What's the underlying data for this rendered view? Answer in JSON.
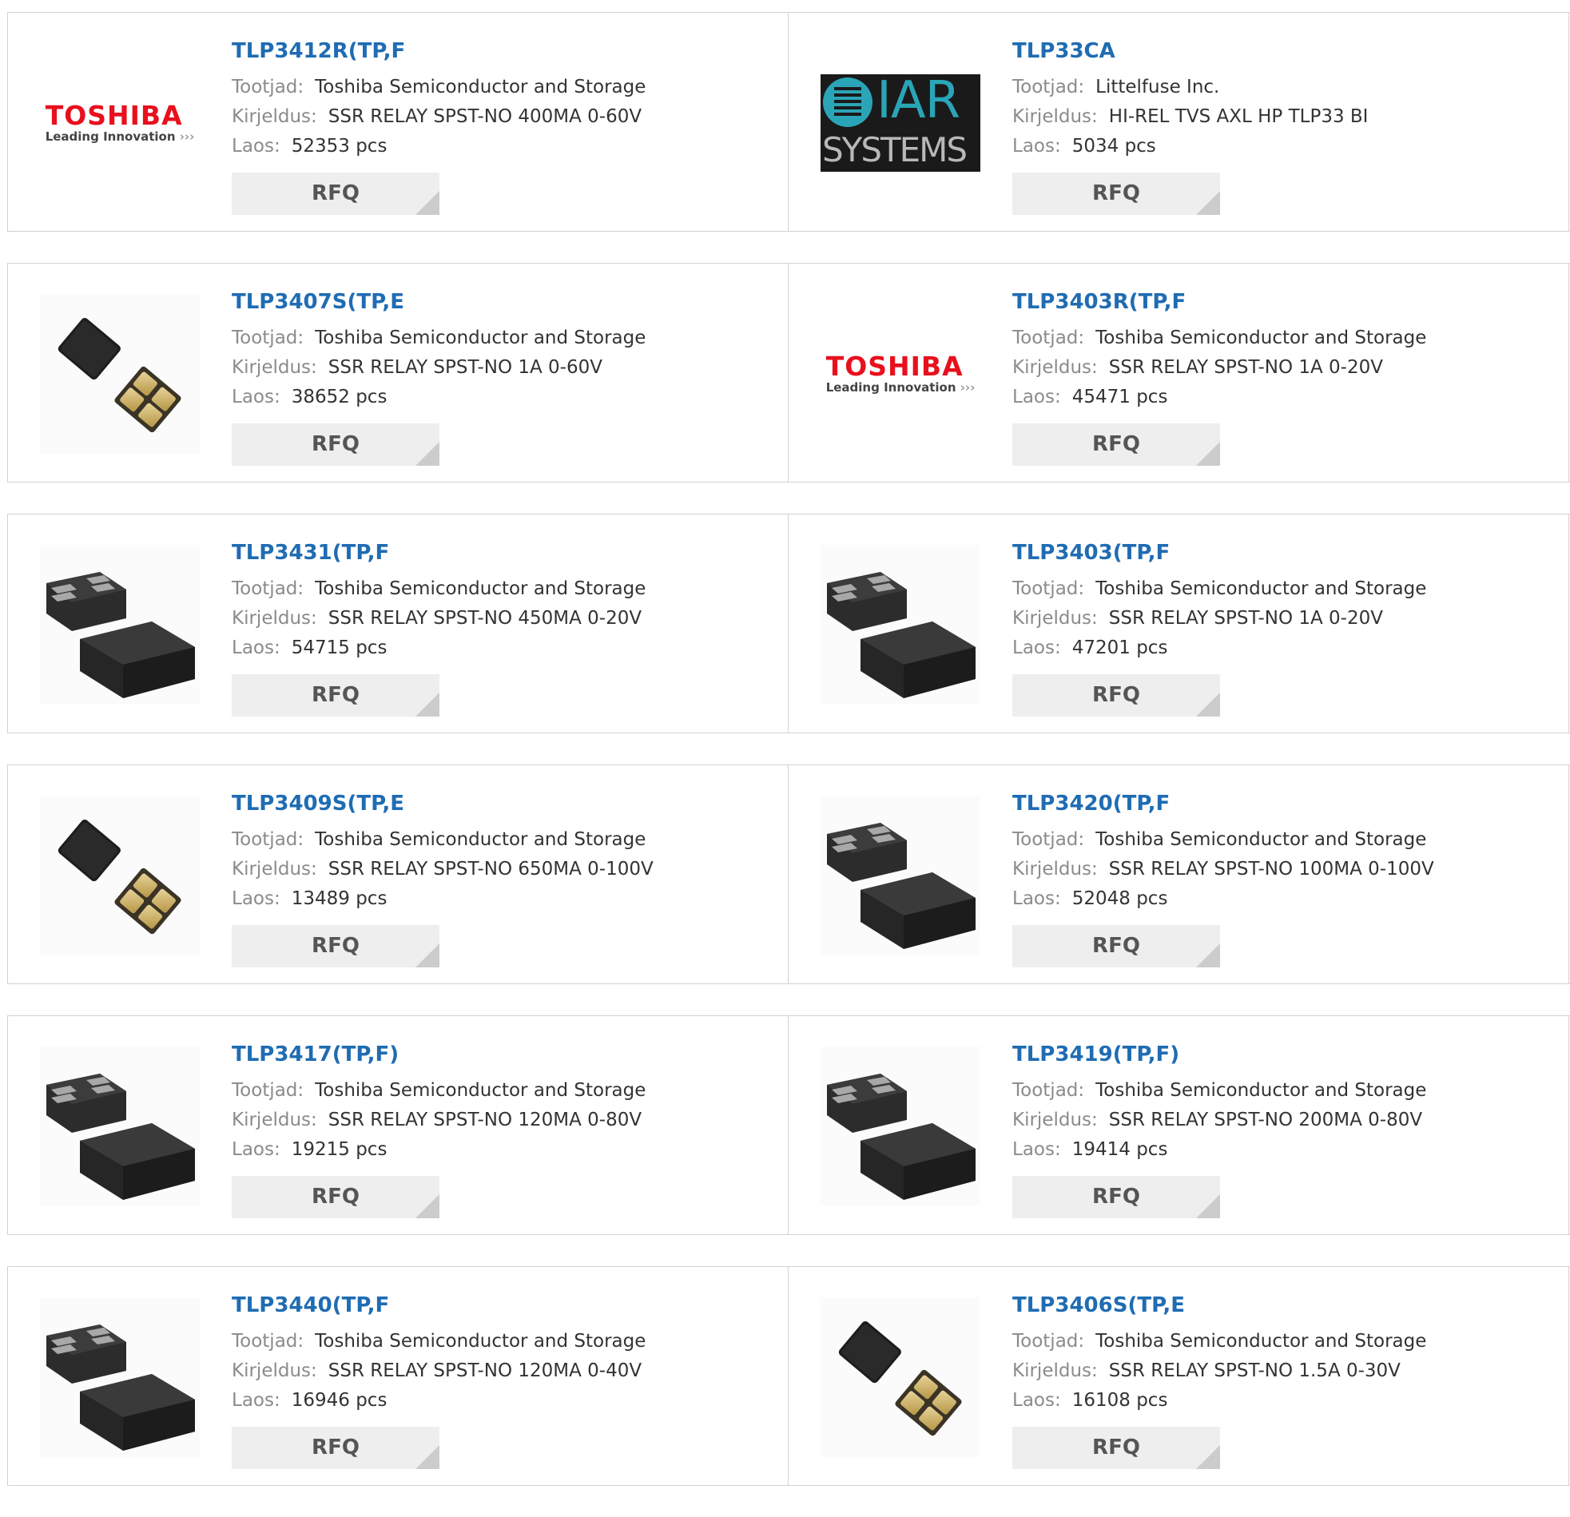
{
  "labels": {
    "manufacturer": "Tootjad:",
    "description": "Kirjeldus:",
    "stock": "Laos:",
    "rfq": "RFQ"
  },
  "logos": {
    "toshiba_name": "TOSHIBA",
    "toshiba_tagline": "Leading Innovation",
    "toshiba_arrows": "›››",
    "iar_letters": "IAR",
    "iar_systems": "SYSTEMS"
  },
  "products": [
    {
      "part": "TLP3412R(TP,F",
      "manufacturer": "Toshiba Semiconductor and Storage",
      "description": "SSR RELAY SPST-NO 400MA 0-60V",
      "stock": "52353 pcs",
      "image": "toshiba-logo"
    },
    {
      "part": "TLP33CA",
      "manufacturer": "Littelfuse Inc.",
      "description": "HI-REL TVS AXL HP TLP33 BI",
      "stock": "5034 pcs",
      "image": "iar-logo"
    },
    {
      "part": "TLP3407S(TP,E",
      "manufacturer": "Toshiba Semiconductor and Storage",
      "description": "SSR RELAY SPST-NO 1A 0-60V",
      "stock": "38652 pcs",
      "image": "small-chip"
    },
    {
      "part": "TLP3403R(TP,F",
      "manufacturer": "Toshiba Semiconductor and Storage",
      "description": "SSR RELAY SPST-NO 1A 0-20V",
      "stock": "45471 pcs",
      "image": "toshiba-logo"
    },
    {
      "part": "TLP3431(TP,F",
      "manufacturer": "Toshiba Semiconductor and Storage",
      "description": "SSR RELAY SPST-NO 450MA 0-20V",
      "stock": "54715 pcs",
      "image": "chip-pair"
    },
    {
      "part": "TLP3403(TP,F",
      "manufacturer": "Toshiba Semiconductor and Storage",
      "description": "SSR RELAY SPST-NO 1A 0-20V",
      "stock": "47201 pcs",
      "image": "chip-pair"
    },
    {
      "part": "TLP3409S(TP,E",
      "manufacturer": "Toshiba Semiconductor and Storage",
      "description": "SSR RELAY SPST-NO 650MA 0-100V",
      "stock": "13489 pcs",
      "image": "small-chip"
    },
    {
      "part": "TLP3420(TP,F",
      "manufacturer": "Toshiba Semiconductor and Storage",
      "description": "SSR RELAY SPST-NO 100MA 0-100V",
      "stock": "52048 pcs",
      "image": "chip-pair"
    },
    {
      "part": "TLP3417(TP,F)",
      "manufacturer": "Toshiba Semiconductor and Storage",
      "description": "SSR RELAY SPST-NO 120MA 0-80V",
      "stock": "19215 pcs",
      "image": "chip-pair"
    },
    {
      "part": "TLP3419(TP,F)",
      "manufacturer": "Toshiba Semiconductor and Storage",
      "description": "SSR RELAY SPST-NO 200MA 0-80V",
      "stock": "19414 pcs",
      "image": "chip-pair"
    },
    {
      "part": "TLP3440(TP,F",
      "manufacturer": "Toshiba Semiconductor and Storage",
      "description": "SSR RELAY SPST-NO 120MA 0-40V",
      "stock": "16946 pcs",
      "image": "chip-pair"
    },
    {
      "part": "TLP3406S(TP,E",
      "manufacturer": "Toshiba Semiconductor and Storage",
      "description": "SSR RELAY SPST-NO 1.5A 0-30V",
      "stock": "16108 pcs",
      "image": "small-chip"
    }
  ]
}
